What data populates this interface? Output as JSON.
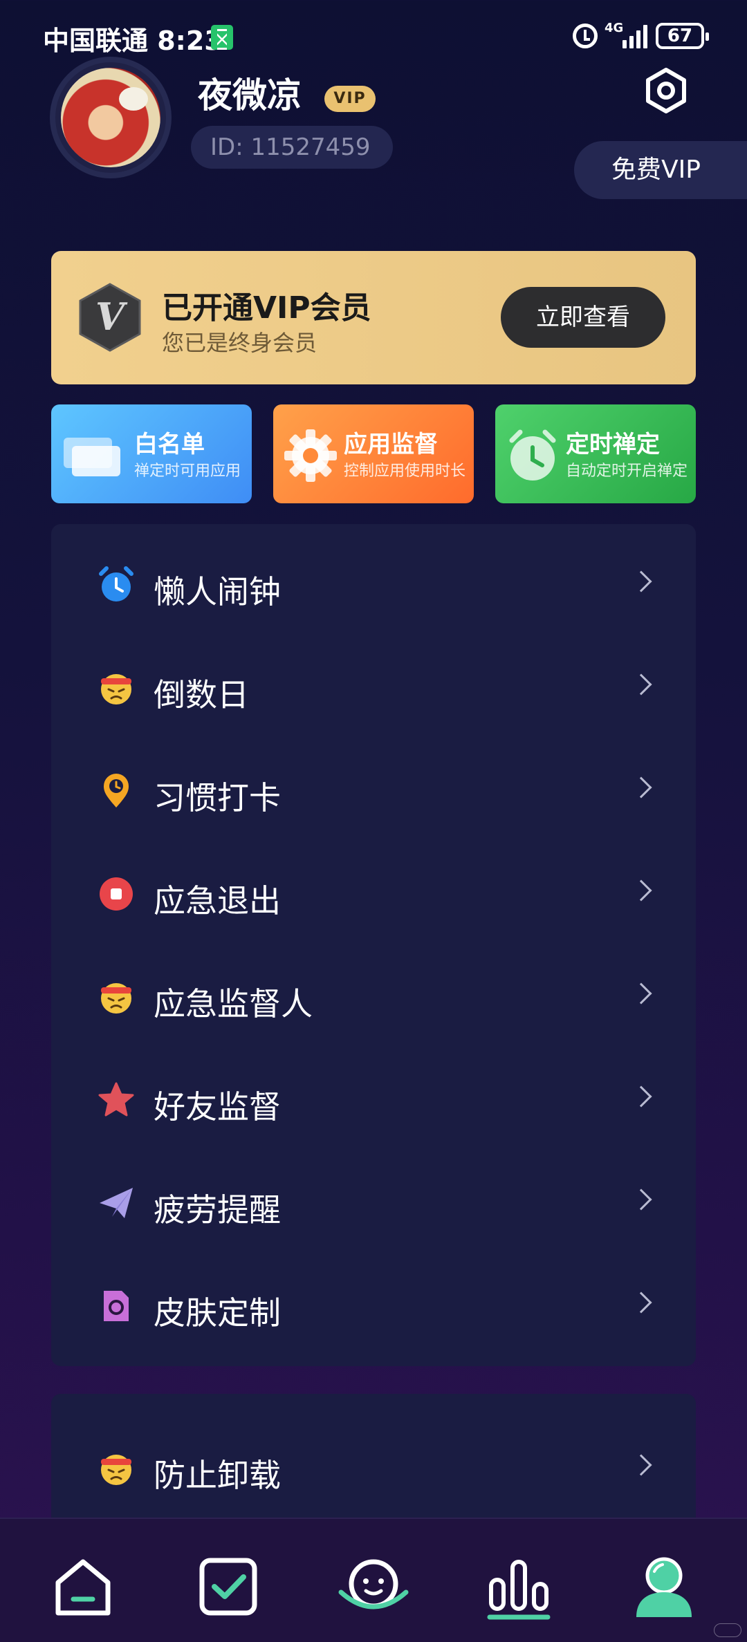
{
  "status_bar": {
    "carrier_time": "中国联通 8:23",
    "network": "4G",
    "battery": "67"
  },
  "profile": {
    "username": "夜微凉",
    "vip_badge": "VIP",
    "user_id": "ID:  11527459",
    "free_vip_label": "免费VIP"
  },
  "vip_card": {
    "title": "已开通VIP会员",
    "subtitle": "您已是终身会员",
    "button_label": "立即查看",
    "logo_letter": "V"
  },
  "tiles": [
    {
      "title": "白名单",
      "subtitle": "禅定时可用应用",
      "icon": "cards-icon"
    },
    {
      "title": "应用监督",
      "subtitle": "控制应用使用时长",
      "icon": "gear-icon"
    },
    {
      "title": "定时禅定",
      "subtitle": "自动定时开启禅定",
      "icon": "alarm-clock-icon"
    }
  ],
  "menu": {
    "items": [
      {
        "label": "懒人闹钟",
        "icon": "alarm-clock-icon"
      },
      {
        "label": "倒数日",
        "icon": "angry-face-icon"
      },
      {
        "label": "习惯打卡",
        "icon": "location-pin-clock-icon"
      },
      {
        "label": "应急退出",
        "icon": "stop-icon"
      },
      {
        "label": "应急监督人",
        "icon": "angry-face-icon"
      },
      {
        "label": "好友监督",
        "icon": "star-icon"
      },
      {
        "label": "疲劳提醒",
        "icon": "paper-plane-icon"
      },
      {
        "label": "皮肤定制",
        "icon": "skin-file-icon"
      }
    ],
    "extra_items": [
      {
        "label": "防止卸载",
        "icon": "angry-face-icon"
      }
    ]
  },
  "bottom_nav": {
    "items": [
      "home-icon",
      "checklist-icon",
      "planet-icon",
      "stats-icon",
      "profile-icon"
    ],
    "active": "profile-icon"
  },
  "colors": {
    "vip_gold": "#e9c170",
    "accent_green": "#4fd1a5",
    "card_bg": "#1a1c42"
  }
}
